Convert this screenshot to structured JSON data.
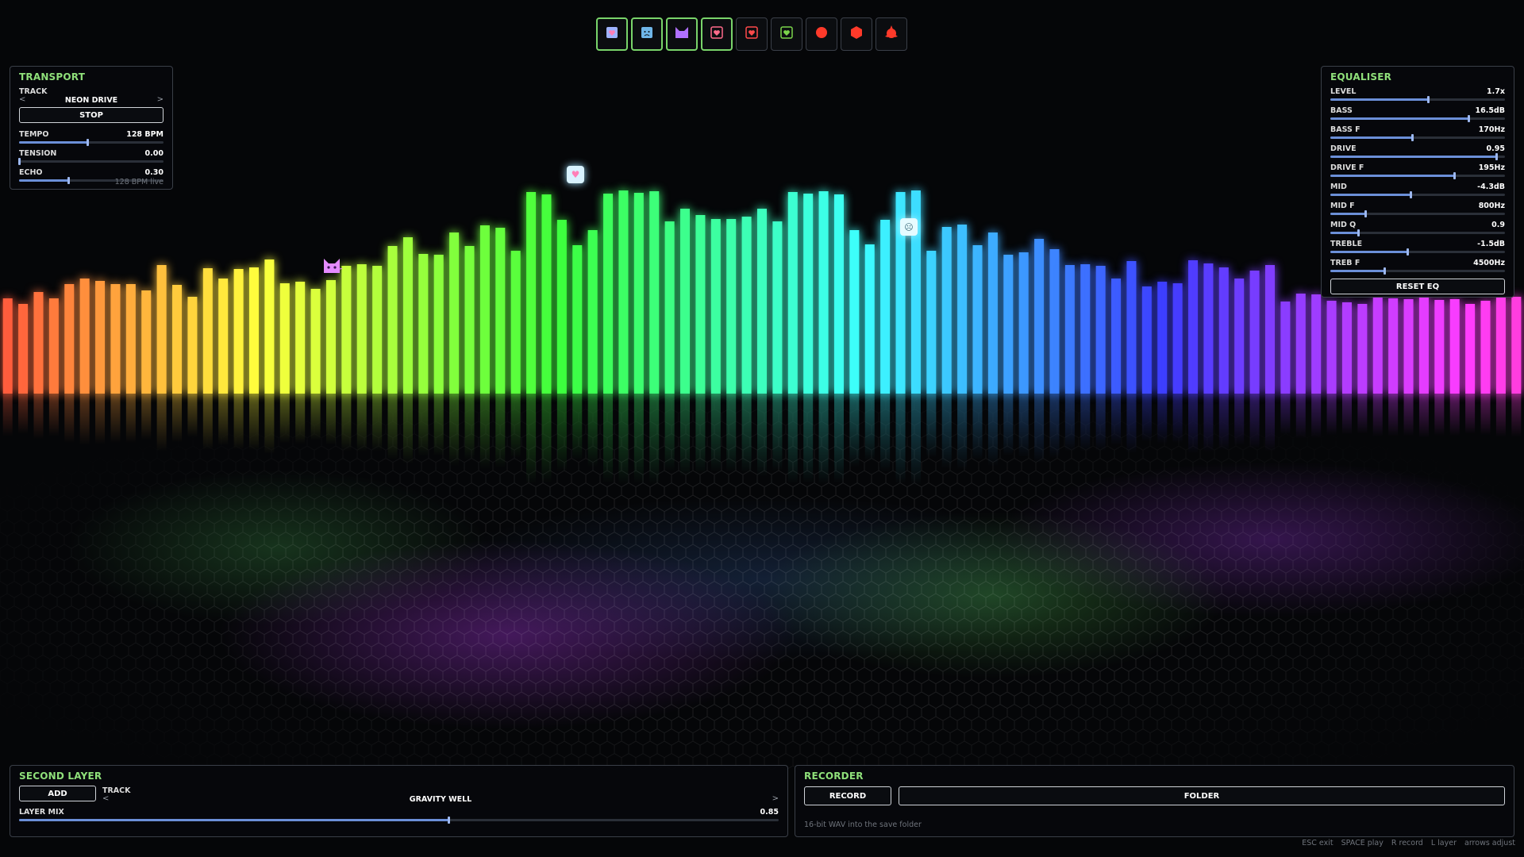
{
  "toolbar": {
    "tools": [
      {
        "icon": "heart-cube-icon",
        "color": "#9fb3ff",
        "active": true
      },
      {
        "icon": "sad-cube-icon",
        "color": "#6fb6e8",
        "active": true
      },
      {
        "icon": "cat-icon",
        "color": "#b070ff",
        "active": true
      },
      {
        "icon": "heart-box-icon",
        "color": "#ff6b8a",
        "active": true
      },
      {
        "icon": "heart-box-red-icon",
        "color": "#ff4a4a",
        "active": false
      },
      {
        "icon": "heart-box-green-icon",
        "color": "#7ad44a",
        "active": false
      },
      {
        "icon": "circle-icon",
        "color": "#ff3a2a",
        "active": false
      },
      {
        "icon": "hexagon-icon",
        "color": "#ff3a2a",
        "active": false
      },
      {
        "icon": "spiky-ball-icon",
        "color": "#ff3a2a",
        "active": false
      }
    ]
  },
  "transport": {
    "title": "TRANSPORT",
    "track_label": "TRACK",
    "track_name": "NEON DRIVE",
    "prev": "<",
    "next": ">",
    "stop_label": "STOP",
    "tempo": {
      "label": "TEMPO",
      "value": "128 BPM",
      "level": 0.47
    },
    "tension": {
      "label": "TENSION",
      "value": "0.00",
      "level": 0.0
    },
    "echo": {
      "label": "ECHO",
      "value": "0.30",
      "level": 0.34
    },
    "status": "128 BPM live"
  },
  "equaliser": {
    "title": "EQUALISER",
    "level": {
      "label": "LEVEL",
      "value": "1.7x",
      "level": 0.56
    },
    "bass": {
      "label": "BASS",
      "value": "16.5dB",
      "level": 0.79
    },
    "bass_f": {
      "label": "BASS F",
      "value": "170Hz",
      "level": 0.47
    },
    "drive": {
      "label": "DRIVE",
      "value": "0.95",
      "level": 0.95
    },
    "drive_f": {
      "label": "DRIVE F",
      "value": "195Hz",
      "level": 0.71
    },
    "mid": {
      "label": "MID",
      "value": "-4.3dB",
      "level": 0.46
    },
    "mid_f": {
      "label": "MID F",
      "value": "800Hz",
      "level": 0.2
    },
    "mid_q": {
      "label": "MID Q",
      "value": "0.9",
      "level": 0.16
    },
    "treble": {
      "label": "TREBLE",
      "value": "-1.5dB",
      "level": 0.44
    },
    "treb_f": {
      "label": "TREB F",
      "value": "4500Hz",
      "level": 0.31
    },
    "reset_label": "RESET EQ"
  },
  "second_layer": {
    "title": "SECOND LAYER",
    "add_label": "ADD",
    "track_label": "TRACK",
    "prev": "<",
    "next": ">",
    "track_name": "GRAVITY WELL",
    "mix": {
      "label": "LAYER MIX",
      "value": "0.85",
      "level": 0.565
    }
  },
  "recorder": {
    "title": "RECORDER",
    "record_label": "RECORD",
    "folder_label": "FOLDER",
    "note": "16-bit WAV into the save folder"
  },
  "hints": [
    "ESC exit",
    "SPACE play",
    "R record",
    "L layer",
    "arrows adjust"
  ],
  "spectrum": {
    "levels": [
      120,
      113,
      128,
      120,
      138,
      145,
      142,
      138,
      138,
      130,
      162,
      137,
      122,
      158,
      145,
      157,
      159,
      169,
      139,
      141,
      132,
      143,
      161,
      163,
      161,
      186,
      197,
      176,
      175,
      203,
      186,
      212,
      209,
      180,
      254,
      251,
      219,
      187,
      206,
      252,
      256,
      253,
      255,
      217,
      233,
      225,
      220,
      220,
      223,
      233,
      217,
      254,
      252,
      255,
      251,
      206,
      188,
      219,
      254,
      256,
      180,
      210,
      213,
      187,
      203,
      175,
      178,
      195,
      182,
      162,
      163,
      161,
      145,
      167,
      135,
      141,
      139,
      168,
      164,
      159,
      145,
      155,
      162,
      116,
      126,
      125,
      117,
      115,
      113,
      121,
      120,
      119,
      124,
      118,
      119,
      113,
      117,
      122,
      122
    ]
  },
  "colors": {
    "accent": "#8fe07a",
    "slider": "#6b8fd8"
  }
}
